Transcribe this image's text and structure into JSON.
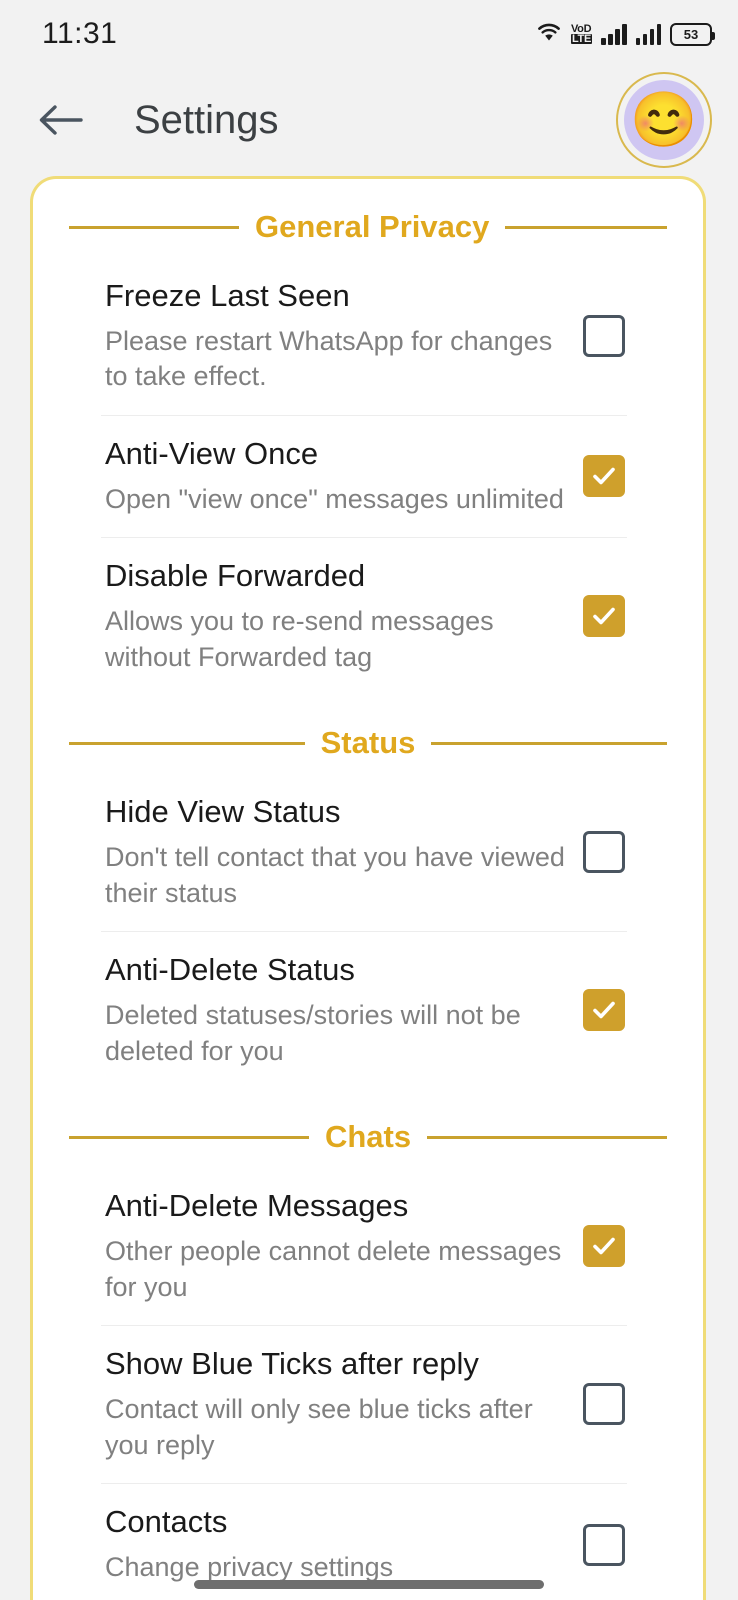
{
  "status_bar": {
    "time": "11:31",
    "wifi_icon": "wifi-icon",
    "volte_line1": "VoD",
    "volte_line2": "LTE",
    "signal_icon_1": "signal-bars-icon",
    "signal_icon_2": "signal-bars-icon",
    "battery_level": "53"
  },
  "app_bar": {
    "back_icon": "back-arrow-icon",
    "title": "Settings",
    "avatar_emoji": "😊"
  },
  "sections": [
    {
      "title": "General Privacy",
      "rows": [
        {
          "title": "Freeze Last Seen",
          "subtitle": "Please restart WhatsApp for changes to take effect.",
          "checked": false
        },
        {
          "title": "Anti-View Once",
          "subtitle": "Open \"view once\" messages unlimited",
          "checked": true
        },
        {
          "title": "Disable Forwarded",
          "subtitle": "Allows you to re-send messages without Forwarded tag",
          "checked": true
        }
      ]
    },
    {
      "title": "Status",
      "rows": [
        {
          "title": "Hide View Status",
          "subtitle": "Don't tell contact that you have viewed their status",
          "checked": false
        },
        {
          "title": "Anti-Delete Status",
          "subtitle": "Deleted statuses/stories will not be deleted for you",
          "checked": true
        }
      ]
    },
    {
      "title": "Chats",
      "rows": [
        {
          "title": "Anti-Delete Messages",
          "subtitle": "Other people cannot delete messages for you",
          "checked": true
        },
        {
          "title": "Show Blue Ticks after reply",
          "subtitle": "Contact will only see blue ticks after you reply",
          "checked": false
        },
        {
          "title": "Contacts",
          "subtitle": "Change privacy settings",
          "checked": false
        }
      ]
    }
  ],
  "colors": {
    "accent_gold": "#CFA02C",
    "header_gold": "#E0A81E",
    "card_border": "#F0DC78",
    "title_text": "#1A1A1A",
    "subtitle_text": "#808080",
    "page_bg": "#F2F2F2"
  },
  "gesture_bar": "gesture-nav-pill"
}
